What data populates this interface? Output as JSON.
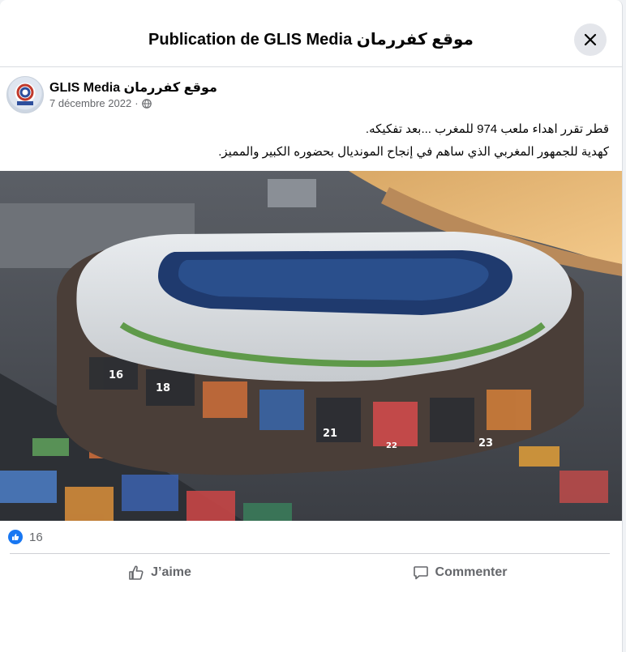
{
  "header": {
    "title": "Publication de GLIS Media موقع كفررمان",
    "close_icon": "close-icon"
  },
  "post": {
    "author": "GLIS Media موقع كفررمان",
    "date": "7 décembre 2022",
    "separator": "·",
    "audience_icon": "globe-icon",
    "text_lines": [
      "قطر تقرر اهداء ملعب 974 للمغرب ...بعد تفكيكه.",
      "كهدية للجمهور المغربي الذي ساهم في إنجاح المونديال بحضوره الكبير والمميز."
    ],
    "photo_container_numbers": [
      "16",
      "18",
      "21",
      "22",
      "23"
    ]
  },
  "reactions": {
    "icon": "like-reaction-icon",
    "count": "16"
  },
  "actions": {
    "like_label": "J’aime",
    "comment_label": "Commenter"
  },
  "colors": {
    "accent": "#1877f2",
    "secondary_text": "#65676b",
    "divider": "#ced0d4"
  }
}
